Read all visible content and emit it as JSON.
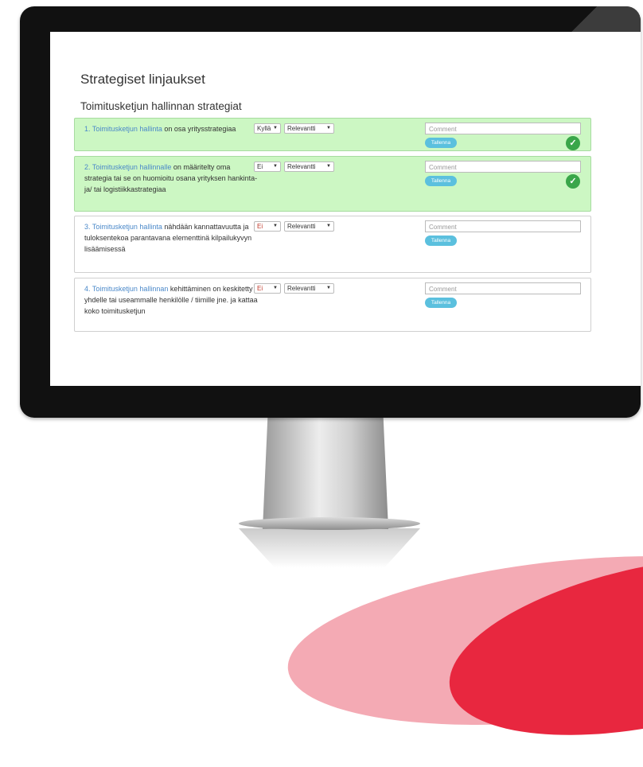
{
  "page": {
    "title": "Strategiset linjaukset",
    "section_title": "Toimitusketjun hallinnan strategiat"
  },
  "colors": {
    "answered_background": "#ccf7c3",
    "link": "#4a88c9",
    "save_button": "#5bc0de",
    "check": "#3aa64a",
    "brand_red": "#e8273f"
  },
  "questions": [
    {
      "link_text": "1. Toimitusketjun hallinta",
      "rest_text": " on osa yritysstrategiaa",
      "answer": "Kyllä",
      "relevance": "Relevantti",
      "comment_placeholder": "Comment",
      "save_label": "Tallenna",
      "saved_icon": "check-icon",
      "check_glyph": "✓"
    },
    {
      "link_text": "2. Toimitusketjun hallinnalle",
      "rest_text": " on määritelty oma strategia tai se on huomioitu osana yrityksen hankinta- ja/ tai logistiikkastrategiaa",
      "answer": "Ei",
      "relevance": "Relevantti",
      "comment_placeholder": "Comment",
      "save_label": "Tallenna",
      "saved_icon": "check-icon",
      "check_glyph": "✓"
    },
    {
      "link_text": "3. Toimitusketjun hallinta",
      "rest_text": " nähdään kannattavuutta ja tuloksentekoa parantavana elementtinä kilpailukyvyn lisäämisessä",
      "answer": "Ei",
      "relevance": "Relevantti",
      "comment_placeholder": "Comment",
      "save_label": "Tallenna"
    },
    {
      "link_text": "4. Toimitusketjun hallinnan",
      "rest_text": " kehittäminen on keskitetty yhdelle tai useammalle henkilölle / tiimille jne. ja kattaa koko toimitusketjun",
      "answer": "Ei",
      "relevance": "Relevantti",
      "comment_placeholder": "Comment",
      "save_label": "Tallenna"
    }
  ]
}
